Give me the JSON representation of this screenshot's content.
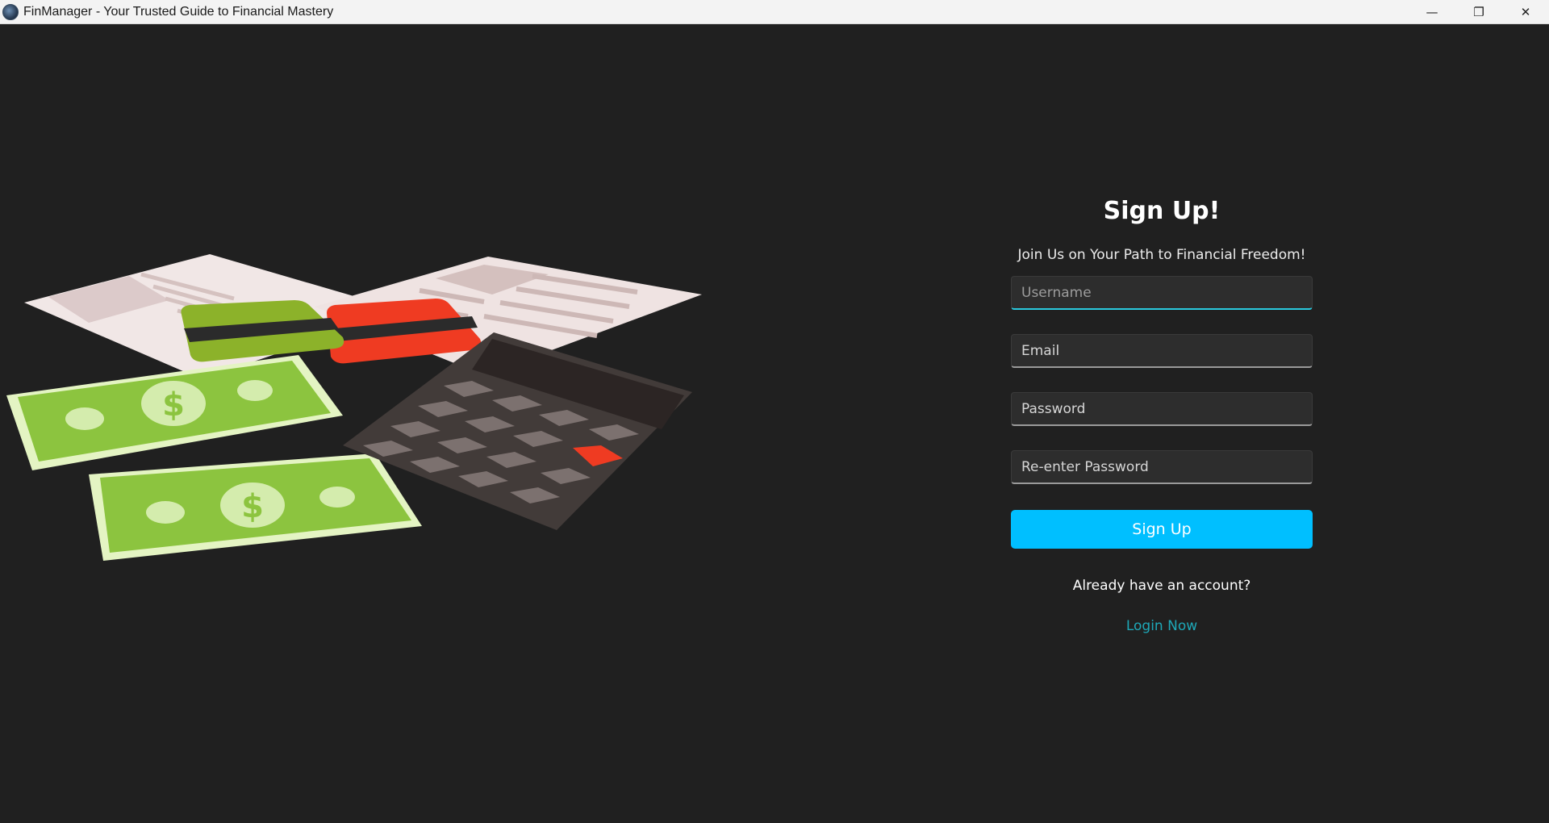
{
  "window": {
    "title": "FinManager - Your Trusted Guide to Financial Mastery",
    "controls": {
      "minimize": "—",
      "restore": "❐",
      "close": "✕"
    }
  },
  "signup": {
    "heading": "Sign Up!",
    "subtitle": "Join Us on Your Path to Financial Freedom!",
    "username_placeholder": "Username",
    "email_placeholder": "Email",
    "password_placeholder": "Password",
    "reenter_placeholder": "Re-enter Password",
    "button_label": "Sign Up",
    "already_text": "Already have an account?",
    "login_link": "Login Now"
  },
  "colors": {
    "background": "#202020",
    "accent": "#00bfff",
    "focus_underline": "#2ac9de",
    "link": "#1ea8b8"
  },
  "illustration": {
    "icons": [
      "documents-icon",
      "credit-card-icon",
      "dollar-bill-icon",
      "calculator-icon"
    ],
    "currency_symbol": "$"
  }
}
